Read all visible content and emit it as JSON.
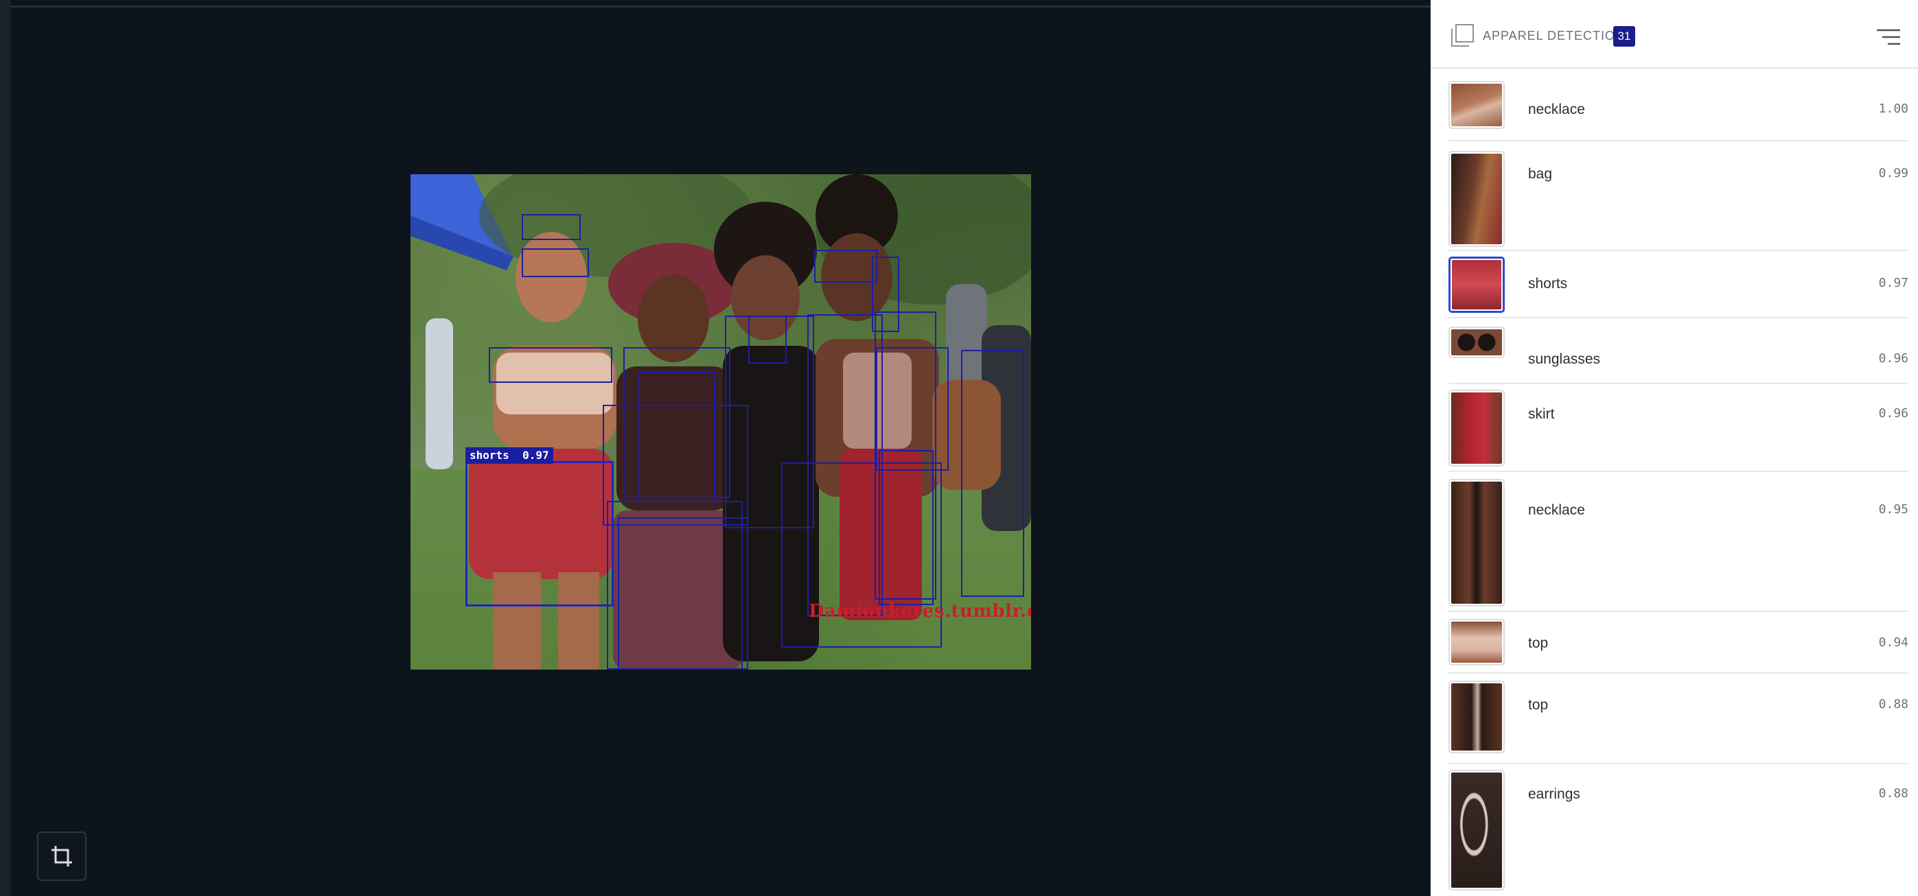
{
  "panel": {
    "title": "APPAREL DETECTION",
    "count": "31",
    "items": [
      {
        "label": "necklace",
        "score": "1.00"
      },
      {
        "label": "bag",
        "score": "0.99"
      },
      {
        "label": "shorts",
        "score": "0.97",
        "selected": true
      },
      {
        "label": "sunglasses",
        "score": "0.96"
      },
      {
        "label": "skirt",
        "score": "0.96"
      },
      {
        "label": "necklace",
        "score": "0.95"
      },
      {
        "label": "top",
        "score": "0.94"
      },
      {
        "label": "top",
        "score": "0.88"
      },
      {
        "label": "earrings",
        "score": "0.88"
      }
    ]
  },
  "image": {
    "selected_label": "shorts",
    "selected_score": "0.97",
    "watermark": "Damionkeres.tumblr.com"
  },
  "icons": {
    "header": "copy-icon",
    "menu": "sort-menu-icon",
    "crop": "crop-icon"
  },
  "colors": {
    "accent": "#1a1d8c",
    "box": "#1d1fa3",
    "selected_thumb": "#2c47d6"
  }
}
